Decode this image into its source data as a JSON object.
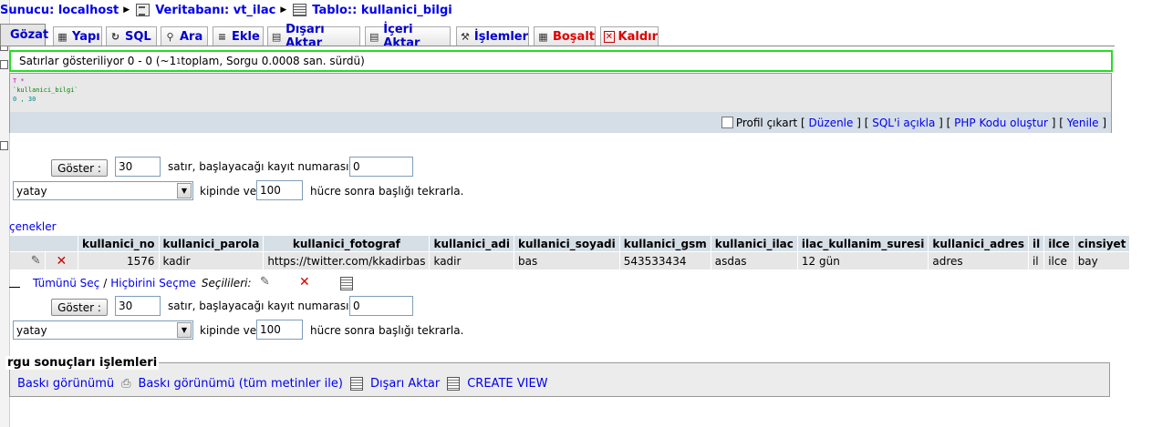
{
  "breadcrumb": {
    "server": "Sunucu: localhost",
    "database": "Veritabanı: vt_ilac",
    "table": "Tablo:: kullanici_bilgi"
  },
  "tabs": [
    {
      "label": "Gözat",
      "icon": "browse-icon"
    },
    {
      "label": "Yapı",
      "icon": "structure-icon"
    },
    {
      "label": "SQL",
      "icon": "sql-icon"
    },
    {
      "label": "Ara",
      "icon": "search-icon"
    },
    {
      "label": "Ekle",
      "icon": "insert-icon"
    },
    {
      "label": "Dışarı Aktar",
      "icon": "export-icon"
    },
    {
      "label": "İçeri Aktar",
      "icon": "import-icon"
    },
    {
      "label": "İşlemler",
      "icon": "operations-icon"
    },
    {
      "label": "Boşalt",
      "icon": "empty-icon"
    },
    {
      "label": "Kaldır",
      "icon": "drop-icon"
    }
  ],
  "notice": {
    "text_before": "Satırlar gösteriliyor 0 - 0 (~1",
    "sup": "1",
    "text_after": " toplam, Sorgu 0.0008 san. sürdü)"
  },
  "sql": {
    "line1": "T *",
    "line2": "`kullanici_bilgi`",
    "line3": "0 , 30"
  },
  "sql_options": {
    "profile": "Profil çıkart",
    "edit": "Düzenle",
    "explain": "SQL'i açıkla",
    "php": "PHP Kodu oluştur",
    "refresh": "Yenile"
  },
  "nav": {
    "show_button": "Göster :",
    "rows_value": "30",
    "rows_text": "satır, başlayacağı kayıt numarası:",
    "start_value": "0",
    "mode_value": "yatay",
    "mode_text": "kipinde ve",
    "repeat_value": "100",
    "repeat_text": "hücre sonra başlığı tekrarla."
  },
  "options_link": "çenekler",
  "table": {
    "headers": [
      "kullanici_no",
      "kullanici_parola",
      "kullanici_fotograf",
      "kullanici_adi",
      "kullanici_soyadi",
      "kullanici_gsm",
      "kullanici_ilac",
      "ilac_kullanim_suresi",
      "kullanici_adres",
      "il",
      "ilce",
      "cinsiyet"
    ],
    "rows": [
      [
        "1576",
        "kadir",
        "https://twitter.com/kkadirbas",
        "kadir",
        "bas",
        "543533434",
        "asdas",
        "12 gün",
        "adres",
        "il",
        "ilce",
        "bay"
      ]
    ]
  },
  "selection": {
    "select_all": "Tümünü Seç",
    "separator": "/",
    "select_none": "Hiçbirini Seçme",
    "selected": "Seçilileri:"
  },
  "query_ops": {
    "legend": "rgu sonuçları işlemleri",
    "print_view": "Baskı görünümü",
    "print_view_full": "Baskı görünümü (tüm metinler ile)",
    "export": "Dışarı Aktar",
    "create_view": "CREATE VIEW"
  }
}
